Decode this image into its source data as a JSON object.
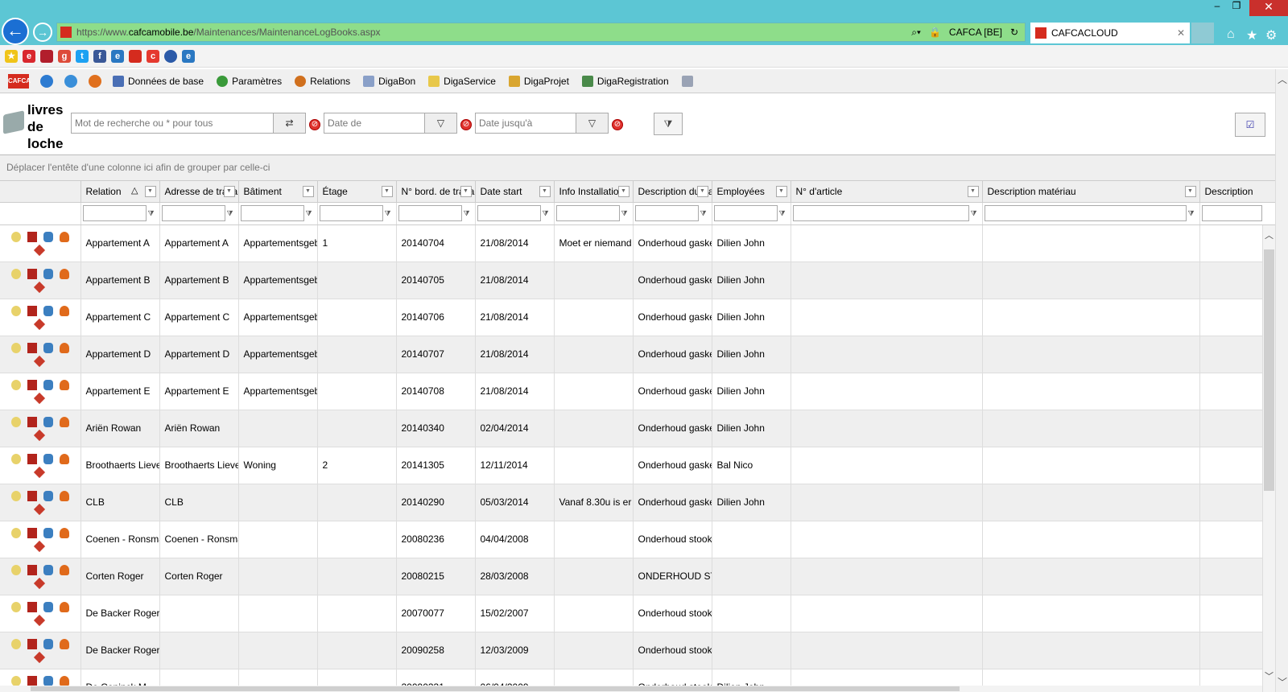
{
  "browser": {
    "url_prefix": "https://www.",
    "url_domain": "cafcamobile.be",
    "url_path": "/Maintenances/MaintenanceLogBooks.aspx",
    "site_identity": "CAFCA [BE]",
    "tab_title": "CAFCACLOUD"
  },
  "app_menu": {
    "logo_text": "CAFCA",
    "items": [
      "Données de base",
      "Paramètres",
      "Relations",
      "DigaBon",
      "DigaService",
      "DigaProjet",
      "DigaRegistration"
    ]
  },
  "page": {
    "title": "livres de loche",
    "search_placeholder": "Mot de recherche ou * pour tous",
    "date_from_placeholder": "Date de",
    "date_to_placeholder": "Date jusqu'à"
  },
  "grid": {
    "group_hint": "Déplacer l'entête d'une colonne ici afin de grouper par celle-ci",
    "columns": [
      "Relation",
      "Adresse de travail",
      "Bâtiment",
      "Étage",
      "N° bord. de travail",
      "Date start",
      "Info Installation",
      "Description du travail",
      "Employées",
      "N° d'article",
      "Description matériau",
      "Description"
    ],
    "rows": [
      [
        "Appartement A",
        "Appartement A",
        "Appartementsgebouw",
        "1",
        "20140704",
        "21/08/2014",
        "Moet er niemand",
        "Onderhoud gasketel",
        "Dilien John",
        "",
        "",
        ""
      ],
      [
        "Appartement B",
        "Appartement B",
        "Appartementsgebouw",
        "",
        "20140705",
        "21/08/2014",
        "",
        "Onderhoud gasketel",
        "Dilien John",
        "",
        "",
        ""
      ],
      [
        "Appartement C",
        "Appartement C",
        "Appartementsgebouw",
        "",
        "20140706",
        "21/08/2014",
        "",
        "Onderhoud gasketel",
        "Dilien John",
        "",
        "",
        ""
      ],
      [
        "Appartement D",
        "Appartement D",
        "Appartementsgebouw",
        "",
        "20140707",
        "21/08/2014",
        "",
        "Onderhoud gasketel",
        "Dilien John",
        "",
        "",
        ""
      ],
      [
        "Appartement E",
        "Appartement E",
        "Appartementsgebouw",
        "",
        "20140708",
        "21/08/2014",
        "",
        "Onderhoud gasketel",
        "Dilien John",
        "",
        "",
        ""
      ],
      [
        "Ariën Rowan",
        "Ariën Rowan",
        "",
        "",
        "20140340",
        "02/04/2014",
        "",
        "Onderhoud gasketel",
        "Dilien John",
        "",
        "",
        ""
      ],
      [
        "Broothaerts Lieve",
        "Broothaerts Lieve",
        "Woning",
        "2",
        "20141305",
        "12/11/2014",
        "",
        "Onderhoud gasketel",
        "Bal Nico",
        "",
        "",
        ""
      ],
      [
        "CLB",
        "CLB",
        "",
        "",
        "20140290",
        "05/03/2014",
        "Vanaf 8.30u is er",
        "Onderhoud gasketel",
        "Dilien John",
        "",
        "",
        ""
      ],
      [
        "Coenen - Ronsmans",
        "Coenen - Ronsmans",
        "",
        "",
        "20080236",
        "04/04/2008",
        "",
        "Onderhoud stookolie",
        "",
        "",
        "",
        ""
      ],
      [
        "Corten Roger",
        "Corten Roger",
        "",
        "",
        "20080215",
        "28/03/2008",
        "",
        "ONDERHOUD STOOKOLIE",
        "",
        "",
        "",
        ""
      ],
      [
        "De Backer Roger",
        "",
        "",
        "",
        "20070077",
        "15/02/2007",
        "",
        "Onderhoud stookolie",
        "",
        "",
        "",
        ""
      ],
      [
        "De Backer Roger",
        "",
        "",
        "",
        "20090258",
        "12/03/2009",
        "",
        "Onderhoud stookolie",
        "",
        "",
        "",
        ""
      ],
      [
        "De Coninck M",
        "",
        "",
        "",
        "20090331",
        "06/04/2009",
        "",
        "Onderhoud stookolie",
        "Dilien John",
        "",
        "",
        ""
      ]
    ]
  },
  "colors": {
    "chrome": "#5cc6d4",
    "address_bar": "#8edd8a",
    "brand_red": "#d52b1e"
  }
}
